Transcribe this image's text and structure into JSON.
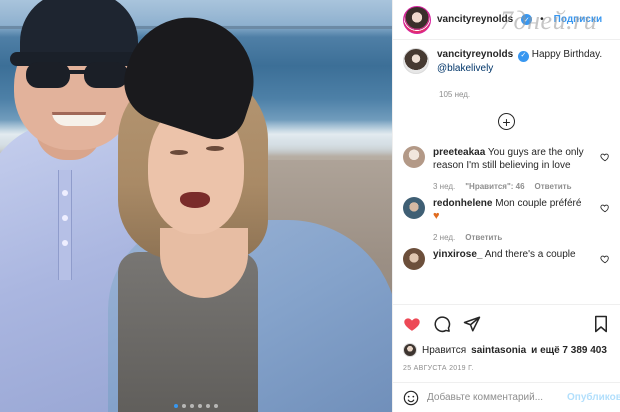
{
  "watermark": "7дней.ru",
  "header": {
    "username": "vancityreynolds",
    "verified_mark": "✓",
    "separator": "•",
    "follow_label": "Подписки"
  },
  "caption": {
    "username": "vancityreynolds",
    "verified_mark": "✓",
    "text": "Happy Birthday.",
    "mention": "@blakelively",
    "time": "105 нед."
  },
  "load_more_symbol": "+",
  "comments": [
    {
      "username": "preeteakaa",
      "text": "You guys are the only reason I'm still believing in love",
      "time": "3 нед.",
      "likes": "\"Нравится\": 46",
      "reply": "Ответить",
      "avatar_color": "#c9b7a8"
    },
    {
      "username": "redonhelene",
      "text": "Mon couple préféré",
      "emoji": "♥",
      "time": "2 нед.",
      "reply": "Ответить",
      "avatar_color": "#5d7a8c"
    },
    {
      "username": "yinxirose_",
      "text": "And there's a couple",
      "avatar_color": "#8a6b52"
    }
  ],
  "actions": {
    "like_icon": "heart-icon",
    "comment_icon": "comment-icon",
    "share_icon": "share-icon",
    "save_icon": "bookmark-icon",
    "likes_prefix": "Нравится",
    "likes_user": "saintasonia",
    "likes_suffix": "и ещё 7 389 403",
    "date": "25 АВГУСТА 2019 Г."
  },
  "add_comment": {
    "placeholder": "Добавьте комментарий...",
    "publish_label": "Опубликовать"
  },
  "colors": {
    "link": "#3897f0",
    "like_red": "#ed4956",
    "muted": "#8e8e8e"
  }
}
